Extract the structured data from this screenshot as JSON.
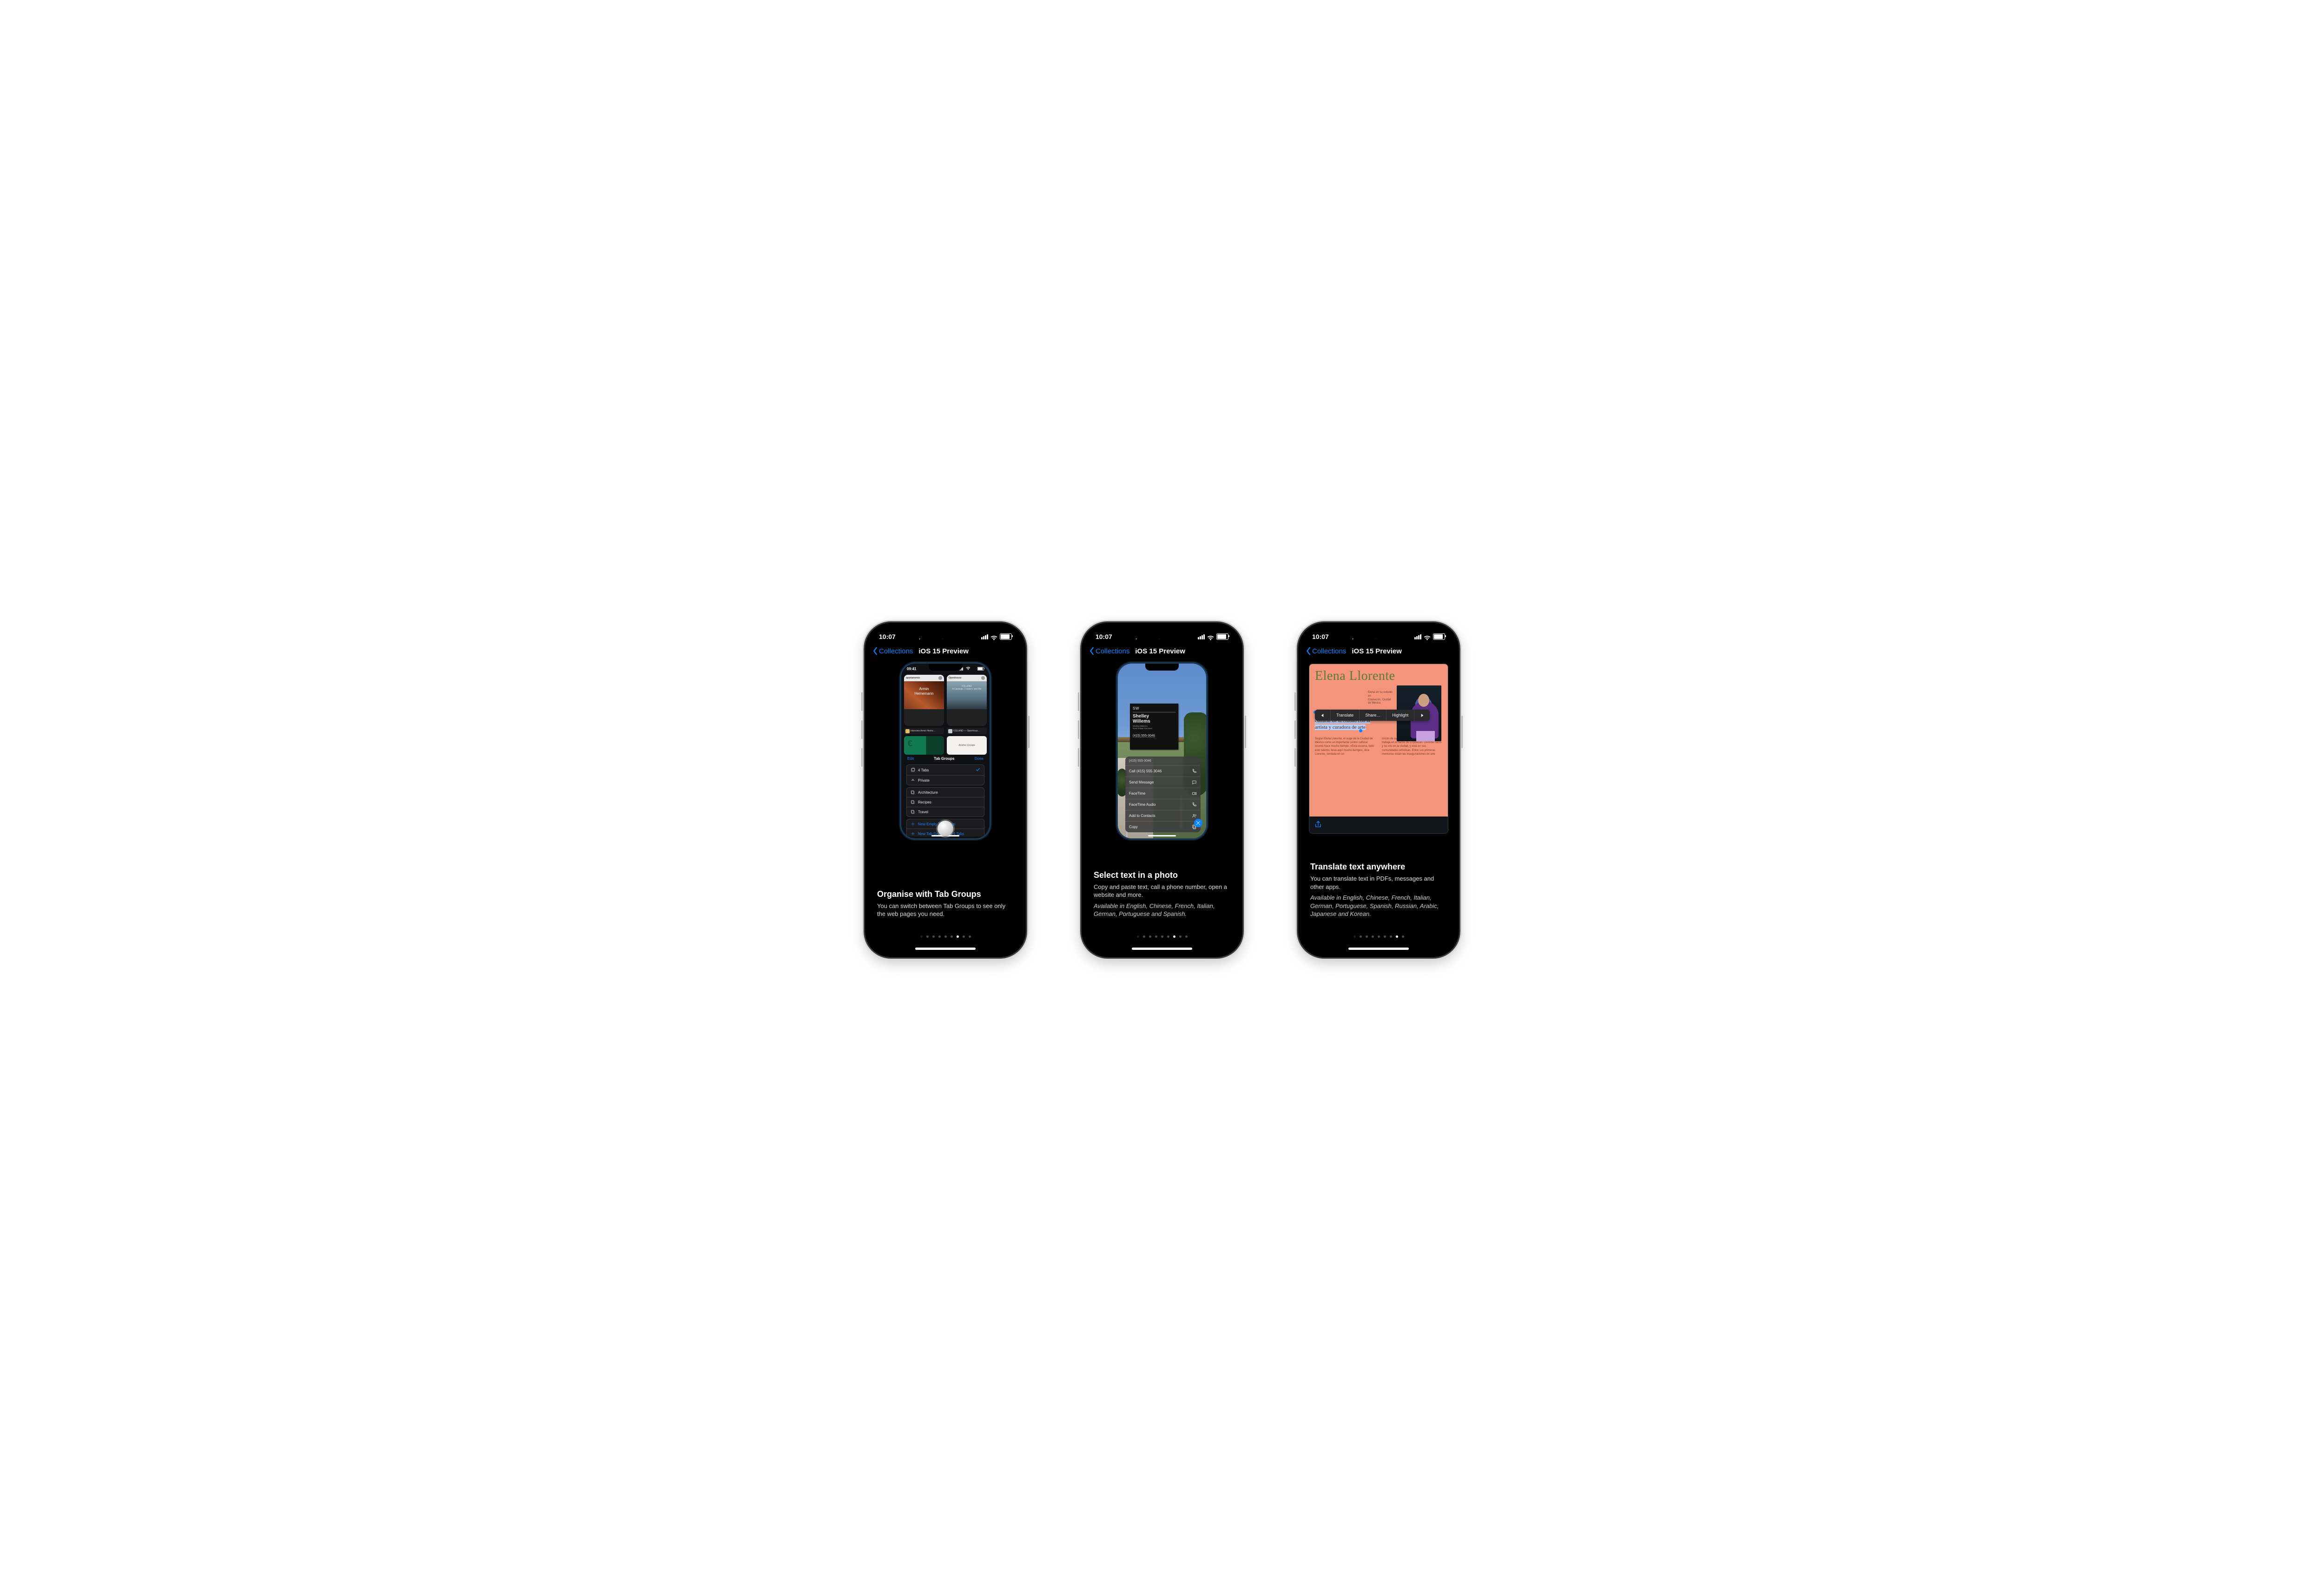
{
  "status": {
    "time": "10:07"
  },
  "nav": {
    "back": "Collections",
    "title": "iOS 15 Preview"
  },
  "screens": [
    {
      "feature_title": "Organise with Tab Groups",
      "feature_body": "You can switch between Tab Groups to see only the web pages you need.",
      "feature_note": "",
      "mini": {
        "status_time": "09:41",
        "tab_left_site": "apartamento",
        "tab_left_overlay": "Armin\nHeinemann",
        "tab_left_label": "Interview Armin Heine…",
        "tab_right_site": "Openhouse",
        "tab_right_overlay": "ICELAND\nA Caravan, 2 sisters and Me",
        "tab_right_label": "ICELAND — Openhous…",
        "thumb_right": "Another Escape",
        "sheet_edit": "Edit",
        "sheet_title": "Tab Groups",
        "sheet_done": "Done",
        "row_tabs": "4 Tabs",
        "row_private": "Private",
        "row_arch": "Architecture",
        "row_recipes": "Recipes",
        "row_travel": "Travel",
        "row_new_empty": "New Empty Tab Group",
        "row_new_from": "New Tab Group from 4 Tabs"
      },
      "active_dot": 6
    },
    {
      "feature_title": "Select text in a photo",
      "feature_body": "Copy and paste text, call a phone number, open a website and more.",
      "feature_note": "Available in English, Chinese, French, Italian, German, Portuguese and Spanish.",
      "mini": {
        "sign_initials": "SW",
        "sign_name": "Shelley\nWillems",
        "sign_sub": "Shelley Willems\nReal Estate Services",
        "sign_phone": "(415) 555-3046",
        "menu_number": "(415) 555-3046",
        "menu_call": "Call (415) 555 3046",
        "menu_message": "Send Message",
        "menu_facetime": "FaceTime",
        "menu_ftaudio": "FaceTime Audio",
        "menu_contacts": "Add to Contacts",
        "menu_copy": "Copy"
      },
      "active_dot": 6
    },
    {
      "feature_title": "Translate text anywhere",
      "feature_body": "You can translate text in PDFs, messages and other apps.",
      "feature_note": "Available in English, Chinese, French, Italian, German, Portuguese, Spanish, Russian, Arabic, Japanese and Korean.",
      "mini": {
        "heading": "Elena Llorente",
        "meta": "Elena en su estudio en\nCoyoacán, Ciudad de México",
        "selection": "Explora la rica escena cultural de la ciudad con la artista y curadora de arte",
        "callout_translate": "Translate",
        "callout_share": "Share…",
        "callout_highlight": "Highlight",
        "col1": "Según Elena Llorente, el auge de la Ciudad de México como un importante centro cultural ocurrió hace mucho tiempo. «Esta escena, todo este talento, lleva aquí mucho tiempo», dice Llorente, sentada en un",
        "col2": "rincón de su soleado estudio donde vive y trabaja en el barrio de Coyoacán. Llorente nació y se crio en la ciudad, y está en sus comunidades artísticas. Entre sus primeras memorias están las inauguraciones de arte"
      },
      "active_dot": 7
    }
  ]
}
